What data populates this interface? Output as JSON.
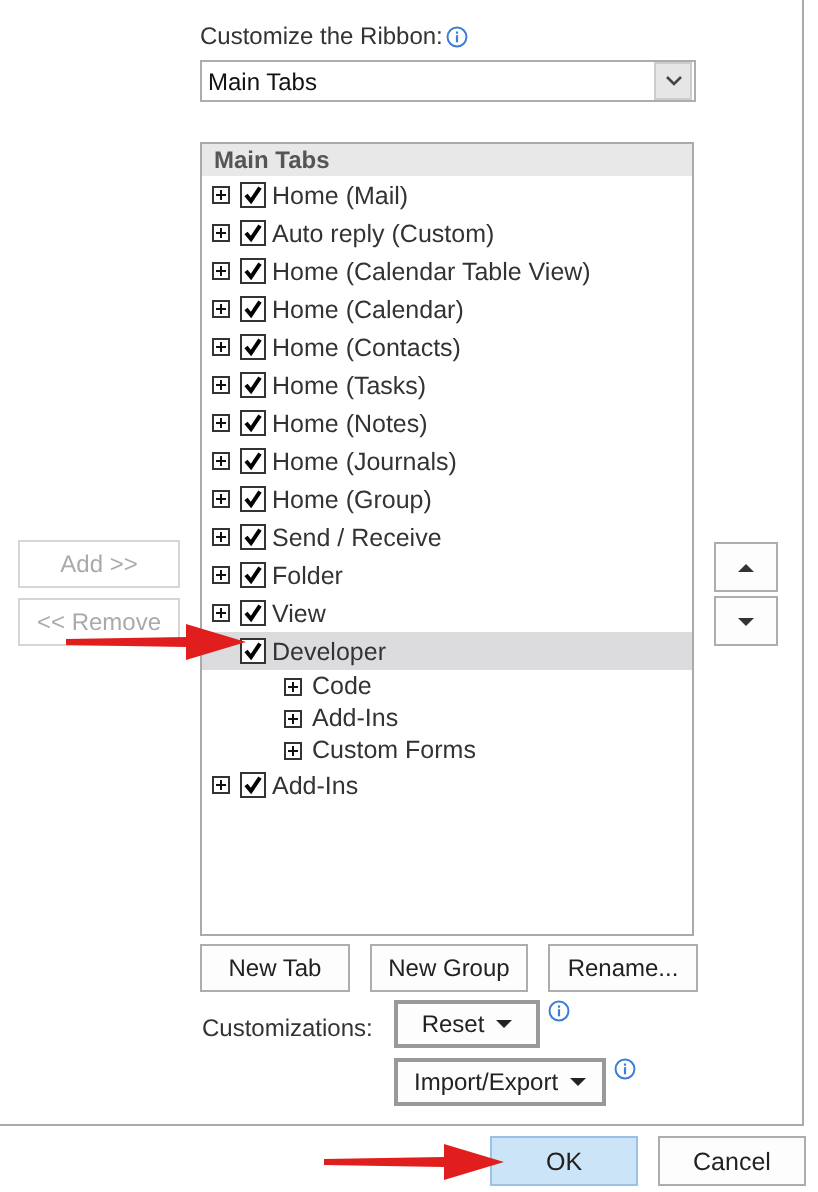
{
  "ribbon_label": "Customize the Ribbon:",
  "ribbon_dropdown": {
    "value": "Main Tabs"
  },
  "tree": {
    "header": "Main Tabs",
    "items": [
      {
        "label": "Home (Mail)",
        "checked": true,
        "expanded": false,
        "selected": false
      },
      {
        "label": "Auto reply (Custom)",
        "checked": true,
        "expanded": false,
        "selected": false
      },
      {
        "label": "Home (Calendar Table View)",
        "checked": true,
        "expanded": false,
        "selected": false
      },
      {
        "label": "Home (Calendar)",
        "checked": true,
        "expanded": false,
        "selected": false
      },
      {
        "label": "Home (Contacts)",
        "checked": true,
        "expanded": false,
        "selected": false
      },
      {
        "label": "Home (Tasks)",
        "checked": true,
        "expanded": false,
        "selected": false
      },
      {
        "label": "Home (Notes)",
        "checked": true,
        "expanded": false,
        "selected": false
      },
      {
        "label": "Home (Journals)",
        "checked": true,
        "expanded": false,
        "selected": false
      },
      {
        "label": "Home (Group)",
        "checked": true,
        "expanded": false,
        "selected": false
      },
      {
        "label": "Send / Receive",
        "checked": true,
        "expanded": false,
        "selected": false
      },
      {
        "label": "Folder",
        "checked": true,
        "expanded": false,
        "selected": false
      },
      {
        "label": "View",
        "checked": true,
        "expanded": false,
        "selected": false
      },
      {
        "label": "Developer",
        "checked": true,
        "expanded": true,
        "selected": true,
        "children": [
          {
            "label": "Code",
            "expanded": false
          },
          {
            "label": "Add-Ins",
            "expanded": false
          },
          {
            "label": "Custom Forms",
            "expanded": false
          }
        ]
      },
      {
        "label": "Add-Ins",
        "checked": true,
        "expanded": false,
        "selected": false
      }
    ]
  },
  "move_buttons": [
    {
      "label": "Add >>",
      "disabled": true
    },
    {
      "label": "<< Remove",
      "disabled": true
    }
  ],
  "tab_buttons": [
    "New Tab",
    "New Group",
    "Rename..."
  ],
  "customizations_label": "Customizations:",
  "reset_button": "Reset",
  "import_export_button": "Import/Export",
  "dialog_buttons": [
    {
      "label": "OK",
      "default": true
    },
    {
      "label": "Cancel",
      "default": false
    }
  ]
}
